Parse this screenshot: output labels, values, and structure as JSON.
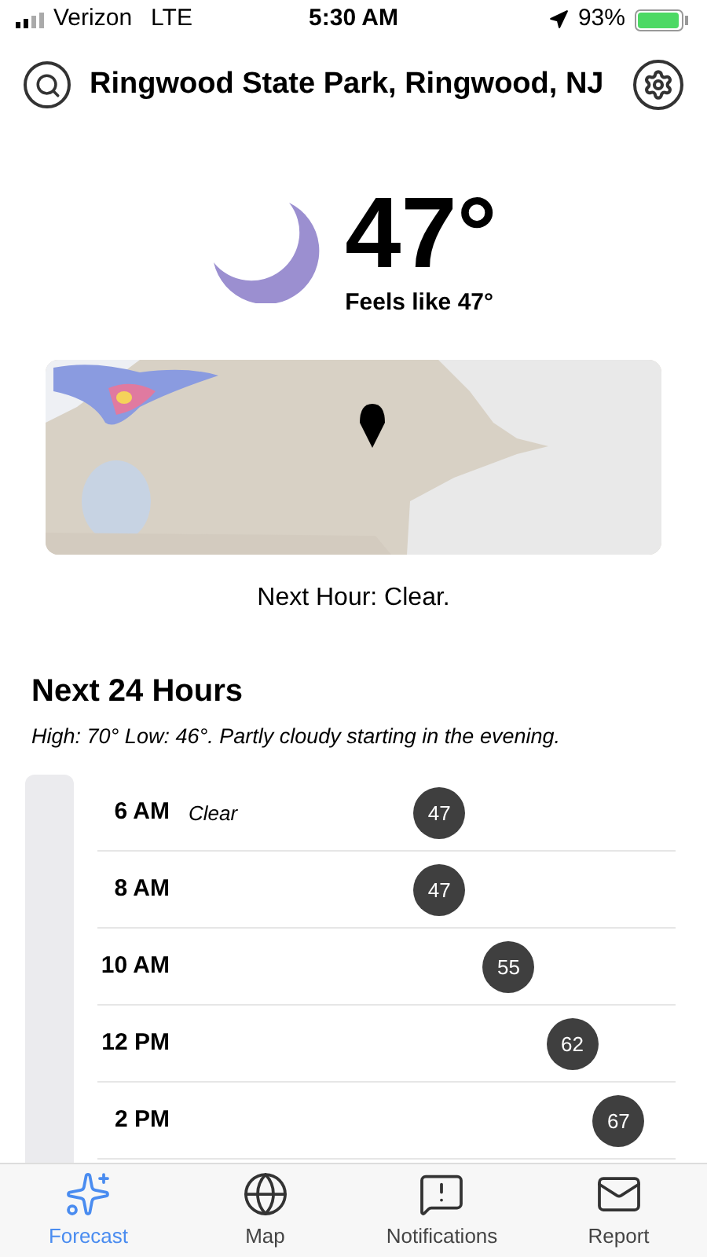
{
  "status_bar": {
    "carrier": "Verizon",
    "network": "LTE",
    "time": "5:30 AM",
    "battery": "93%"
  },
  "header": {
    "location": "Ringwood State Park, Ringwood, NJ"
  },
  "current": {
    "temperature": "47°",
    "feels_like": "Feels like 47°"
  },
  "next_hour": "Next Hour: Clear.",
  "next_24": {
    "title": "Next 24 Hours",
    "summary": "High: 70° Low: 46°. Partly cloudy starting in the evening.",
    "hours": [
      {
        "time": "6 AM",
        "condition": "Clear",
        "temp": "47",
        "level": 0.59
      },
      {
        "time": "8 AM",
        "temp": "47",
        "level": 0.59
      },
      {
        "time": "10 AM",
        "temp": "55",
        "level": 0.71
      },
      {
        "time": "12 PM",
        "temp": "62",
        "level": 0.82
      },
      {
        "time": "2 PM",
        "temp": "67",
        "level": 0.9
      }
    ]
  },
  "tabs": [
    {
      "label": "Forecast",
      "selected": true,
      "kind": "forecast"
    },
    {
      "label": "Map",
      "selected": false,
      "kind": "map"
    },
    {
      "label": "Notifications",
      "selected": false,
      "kind": "notifications"
    },
    {
      "label": "Report",
      "selected": false,
      "kind": "report"
    }
  ]
}
